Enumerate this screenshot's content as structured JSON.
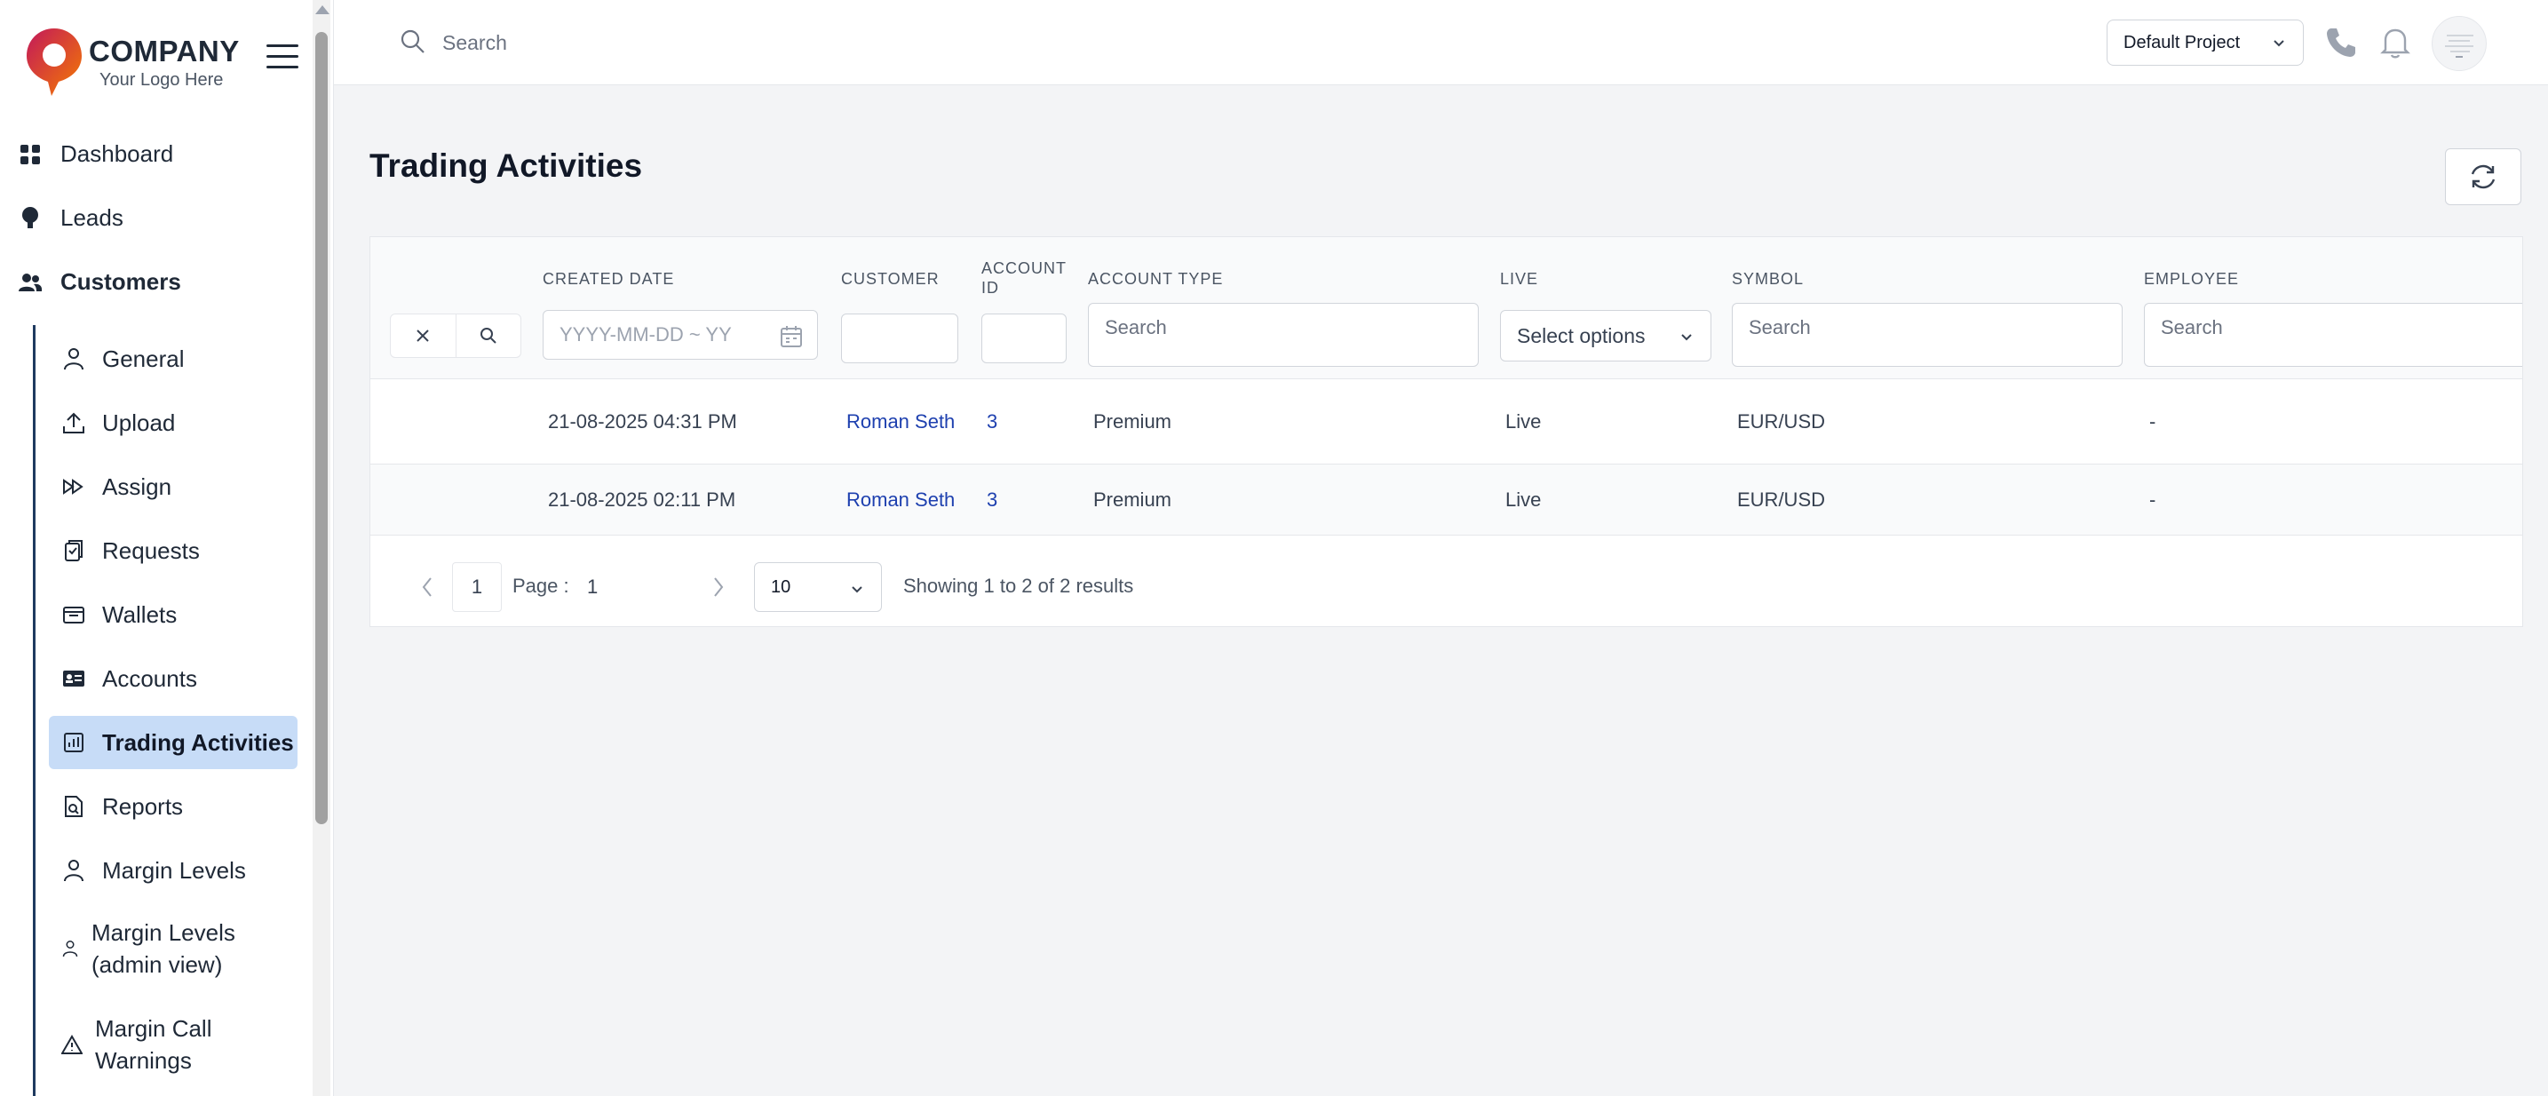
{
  "brand": {
    "company": "COMPANY",
    "tagline": "Your Logo Here"
  },
  "sidebar": {
    "main_items": [
      {
        "label": "Dashboard",
        "icon": "grid-icon"
      },
      {
        "label": "Leads",
        "icon": "lightbulb-icon"
      },
      {
        "label": "Customers",
        "icon": "users-icon"
      }
    ],
    "sub_items": [
      {
        "label": "General",
        "icon": "user-icon"
      },
      {
        "label": "Upload",
        "icon": "upload-icon"
      },
      {
        "label": "Assign",
        "icon": "fast-forward-icon"
      },
      {
        "label": "Requests",
        "icon": "clipboard-icon"
      },
      {
        "label": "Wallets",
        "icon": "wallet-icon"
      },
      {
        "label": "Accounts",
        "icon": "id-card-icon"
      },
      {
        "label": "Trading Activities",
        "icon": "bar-chart-icon",
        "active": true
      },
      {
        "label": "Reports",
        "icon": "report-icon"
      },
      {
        "label": "Margin Levels",
        "icon": "user-icon"
      },
      {
        "label": "Margin Levels (admin view)",
        "icon": "user-icon"
      },
      {
        "label": "Margin Call Warnings",
        "icon": "warning-icon"
      }
    ]
  },
  "topbar": {
    "search_placeholder": "Search",
    "project": "Default Project"
  },
  "page": {
    "title": "Trading Activities"
  },
  "table": {
    "columns": {
      "created_date": "CREATED DATE",
      "customer": "CUSTOMER",
      "account_id": "ACCOUNT ID",
      "account_type": "ACCOUNT TYPE",
      "live": "LIVE",
      "symbol": "SYMBOL",
      "employee": "EMPLOYEE"
    },
    "filters": {
      "date_placeholder": "YYYY-MM-DD ~ YY",
      "account_type_placeholder": "Search",
      "live_placeholder": "Select options",
      "symbol_placeholder": "Search",
      "employee_placeholder": "Search"
    },
    "rows": [
      {
        "created_date": "21-08-2025 04:31 PM",
        "customer": "Roman Seth",
        "account_id": "3",
        "account_type": "Premium",
        "live": "Live",
        "symbol": "EUR/USD",
        "employee": "-"
      },
      {
        "created_date": "21-08-2025 02:11 PM",
        "customer": "Roman Seth",
        "account_id": "3",
        "account_type": "Premium",
        "live": "Live",
        "symbol": "EUR/USD",
        "employee": "-"
      }
    ]
  },
  "pagination": {
    "current": "1",
    "page_label": "Page :",
    "page_value": "1",
    "page_size": "10",
    "info": "Showing 1 to 2 of 2 results"
  }
}
